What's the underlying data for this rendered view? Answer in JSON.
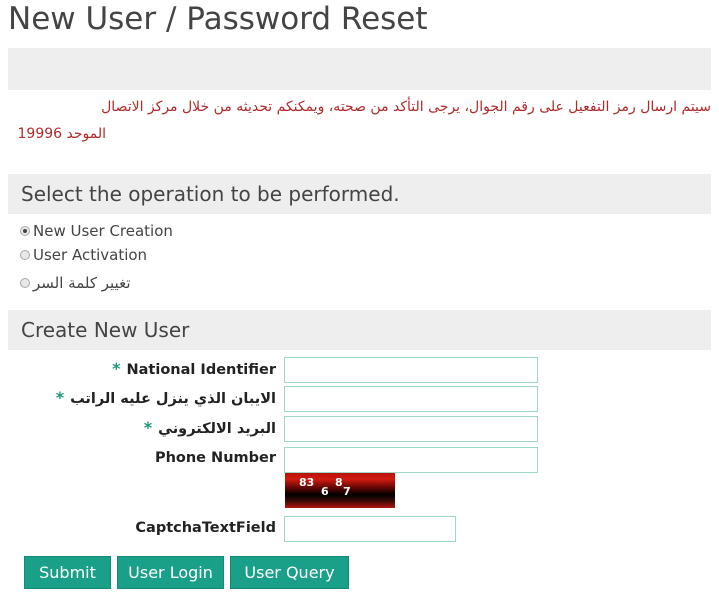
{
  "page": {
    "title": "New User / Password Reset"
  },
  "notice": {
    "line1": "سيتم ارسال رمز التفعيل على رقم الجوال، يرجى التأكد من صحته، ويمكنكم تحديثه من خلال مركز الاتصال",
    "line2": "الموحد 19996"
  },
  "operation": {
    "header": "Select the operation to be performed.",
    "options": [
      {
        "label": "New User Creation",
        "checked": true
      },
      {
        "label": "User Activation",
        "checked": false
      },
      {
        "label": "تغيير كلمة السر",
        "checked": false
      }
    ]
  },
  "create_user": {
    "header": "Create New User",
    "fields": [
      {
        "label": "National Identifier",
        "required": true,
        "value": ""
      },
      {
        "label": "الايبان الذي ينزل عليه الراتب",
        "required": true,
        "value": ""
      },
      {
        "label": "البريد الالكتروني",
        "required": true,
        "value": ""
      },
      {
        "label": "Phone Number",
        "required": false,
        "value": ""
      }
    ],
    "required_mark": "*",
    "captcha": {
      "chars": [
        "83",
        "6",
        "8",
        "7"
      ]
    },
    "captcha_label": "CaptchaTextField",
    "captcha_value": ""
  },
  "buttons": {
    "submit": "Submit",
    "login": "User Login",
    "query": "User Query"
  },
  "colors": {
    "accent": "#1aa088",
    "notice": "#b02a2a",
    "required_star": "#1a9a78",
    "input_border": "#9fd6c6",
    "section_bg": "#eeeeee"
  }
}
